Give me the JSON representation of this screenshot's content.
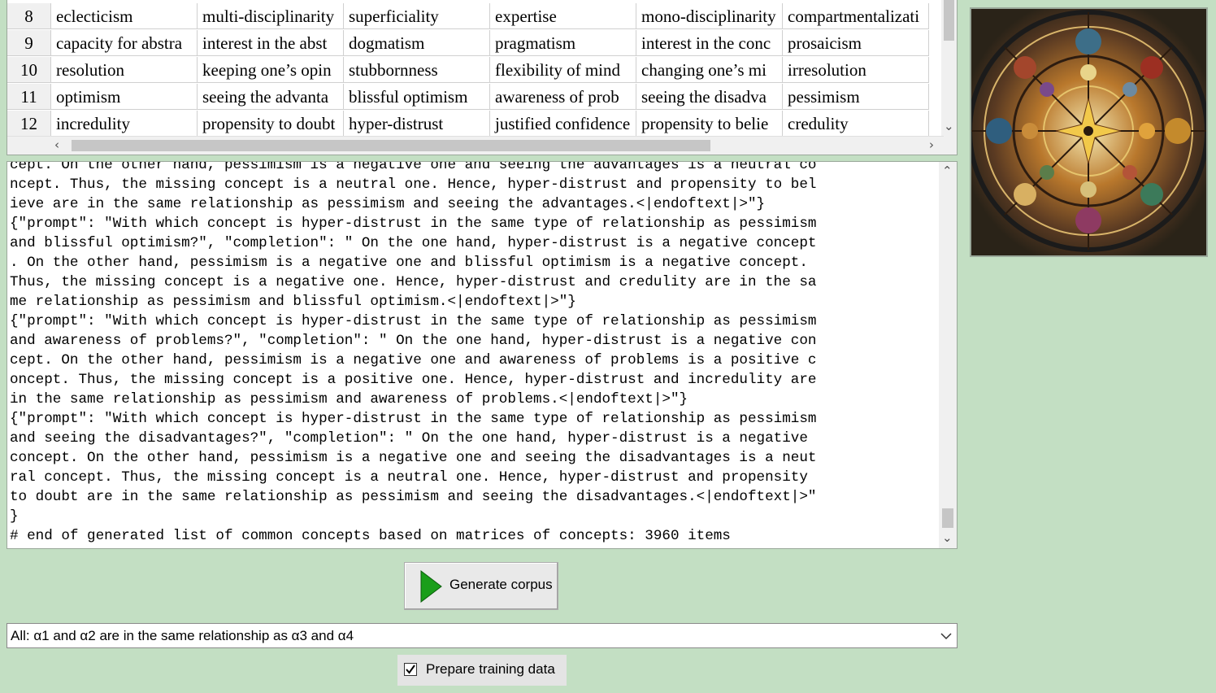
{
  "grid": {
    "rows": [
      {
        "num": "8",
        "cells": [
          "eclecticism",
          "multi-disciplinarity",
          "superficiality",
          "expertise",
          "mono-disciplinarity",
          "compartmentalizati"
        ]
      },
      {
        "num": "9",
        "cells": [
          "capacity for abstra",
          "interest in the abst",
          "dogmatism",
          "pragmatism",
          "interest in the conc",
          "prosaicism"
        ]
      },
      {
        "num": "10",
        "cells": [
          "resolution",
          "keeping one’s opin",
          "stubbornness",
          "flexibility of mind",
          "changing one’s mi",
          "irresolution"
        ]
      },
      {
        "num": "11",
        "cells": [
          "optimism",
          "seeing the advanta",
          "blissful optimism",
          "awareness of prob",
          "seeing the disadva",
          "pessimism"
        ]
      },
      {
        "num": "12",
        "cells": [
          "incredulity",
          "propensity to doubt",
          "hyper-distrust",
          "justified confidence",
          "propensity to belie",
          "credulity"
        ]
      }
    ]
  },
  "memo": {
    "lines": [
      "cept. On the other hand, pessimism is a negative one and seeing the advantages is a neutral co",
      "ncept. Thus, the missing concept is a neutral one. Hence, hyper-distrust and propensity to bel",
      "ieve are in the same relationship as pessimism and seeing the advantages.<|endoftext|>\"}",
      "{\"prompt\": \"With which concept is hyper-distrust in the same type of relationship as pessimism",
      "and blissful optimism?\", \"completion\": \" On the one hand, hyper-distrust is a negative concept",
      ". On the other hand, pessimism is a negative one and blissful optimism is a negative concept.",
      "Thus, the missing concept is a negative one. Hence, hyper-distrust and credulity are in the sa",
      "me relationship as pessimism and blissful optimism.<|endoftext|>\"}",
      "{\"prompt\": \"With which concept is hyper-distrust in the same type of relationship as pessimism",
      "and awareness of problems?\", \"completion\": \" On the one hand, hyper-distrust is a negative con",
      "cept. On the other hand, pessimism is a negative one and awareness of problems is a positive c",
      "oncept. Thus, the missing concept is a positive one. Hence, hyper-distrust and incredulity are",
      "in the same relationship as pessimism and awareness of problems.<|endoftext|>\"}",
      "{\"prompt\": \"With which concept is hyper-distrust in the same type of relationship as pessimism",
      "and seeing the disadvantages?\", \"completion\": \" On the one hand, hyper-distrust is a negative",
      "concept. On the other hand, pessimism is a negative one and seeing the disadvantages is a neut",
      "ral concept. Thus, the missing concept is a neutral one. Hence, hyper-distrust and propensity",
      "to doubt are in the same relationship as pessimism and seeing the disadvantages.<|endoftext|>\"",
      "}",
      "# end of generated list of common concepts based on matrices of concepts: 3960 items"
    ]
  },
  "generate_button": {
    "label": "Generate corpus",
    "icon": "play-icon",
    "icon_color": "#1a9e1a"
  },
  "relation_select": {
    "value": "All: α1 and α2 are in the same relationship as α3 and α4"
  },
  "prepare_checkbox": {
    "label": "Prepare training data",
    "checked": true
  },
  "colors": {
    "background": "#c3dfc3",
    "panel": "#ffffff",
    "accent": "#1a9e1a"
  }
}
